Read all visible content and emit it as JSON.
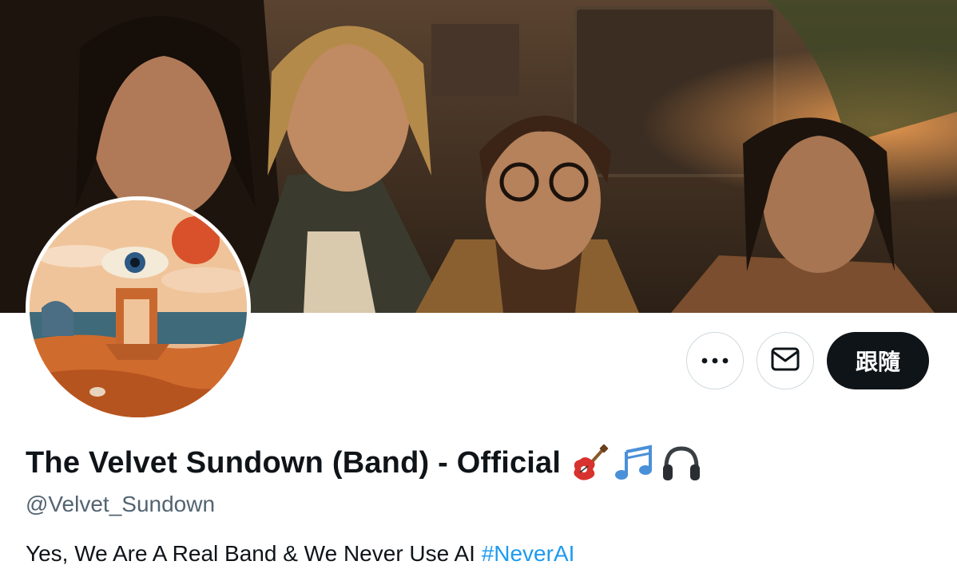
{
  "profile": {
    "display_name": "The Velvet Sundown (Band) - Official",
    "name_emojis": [
      "guitar-emoji",
      "musical-notes-emoji",
      "headphones-emoji"
    ],
    "handle": "@Velvet_Sundown",
    "bio_text": "Yes, We Are A Real Band & We Never Use AI ",
    "bio_hashtag": "#NeverAI"
  },
  "actions": {
    "more_icon": "more-icon",
    "message_icon": "mail-icon",
    "follow_label": "跟隨"
  },
  "colors": {
    "text_primary": "#0f1419",
    "text_secondary": "#536471",
    "link": "#1d9bf0",
    "follow_bg": "#0f1419",
    "border": "#cfd9de"
  }
}
